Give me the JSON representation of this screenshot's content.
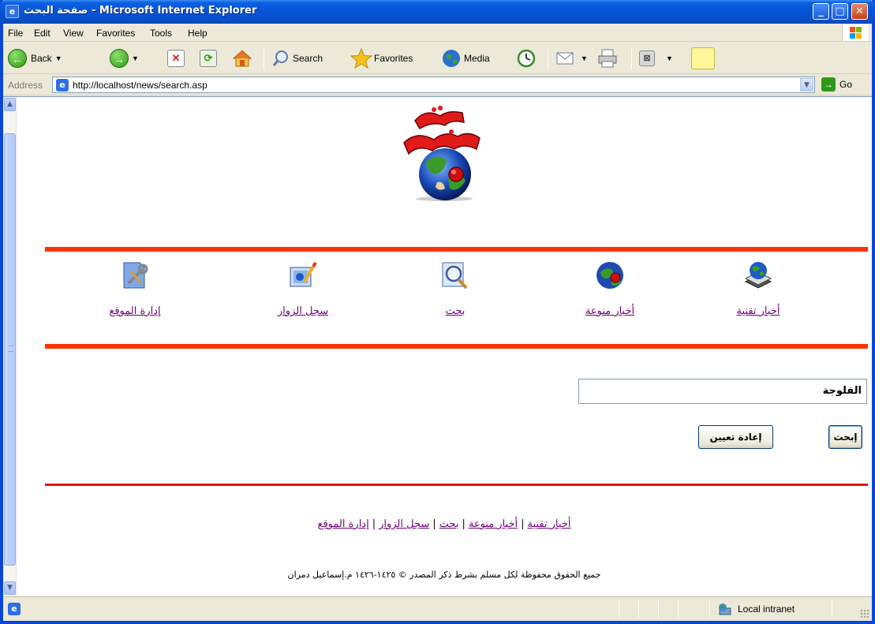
{
  "window": {
    "title": "صفحة البحث - Microsoft Internet Explorer",
    "controls": {
      "minimize": "_",
      "maximize": "□",
      "close": "✕"
    }
  },
  "menu": [
    "File",
    "Edit",
    "View",
    "Favorites",
    "Tools",
    "Help"
  ],
  "toolbar": {
    "back": "Back",
    "search": "Search",
    "favorites": "Favorites",
    "media": "Media"
  },
  "address": {
    "label": "Address",
    "url": "http://localhost/news/search.asp",
    "go": "Go"
  },
  "page": {
    "logo_text": "موقع الأخبار",
    "nav": [
      {
        "label": "أخبار تقنية",
        "icon": "globe-stack-icon"
      },
      {
        "label": "أخبار منوعة",
        "icon": "globe-red-icon"
      },
      {
        "label": "بحث",
        "icon": "magnifier-icon"
      },
      {
        "label": "سجل الزوار",
        "icon": "guestbook-icon"
      },
      {
        "label": "إدارة الموقع",
        "icon": "admin-tools-icon"
      }
    ],
    "search": {
      "value": "الفلوجة",
      "submit": "إبحث",
      "reset": "إعادة تعيين"
    },
    "footer_links": [
      "أخبار تقنية",
      "أخبار منوعة",
      "بحث",
      "سجل الزوار",
      "إدارة الموقع"
    ],
    "copyright": "جميع الحقوق محفوظة لكل مسلم بشرط ذكر المصدر © ١٤٢٥-١٤٢٦ م.إسماعيل دمران"
  },
  "status": {
    "zone": "Local intranet"
  },
  "colors": {
    "accent_rule": "#ff3300",
    "link": "#6e007a",
    "titlebar": "#0654d6"
  }
}
